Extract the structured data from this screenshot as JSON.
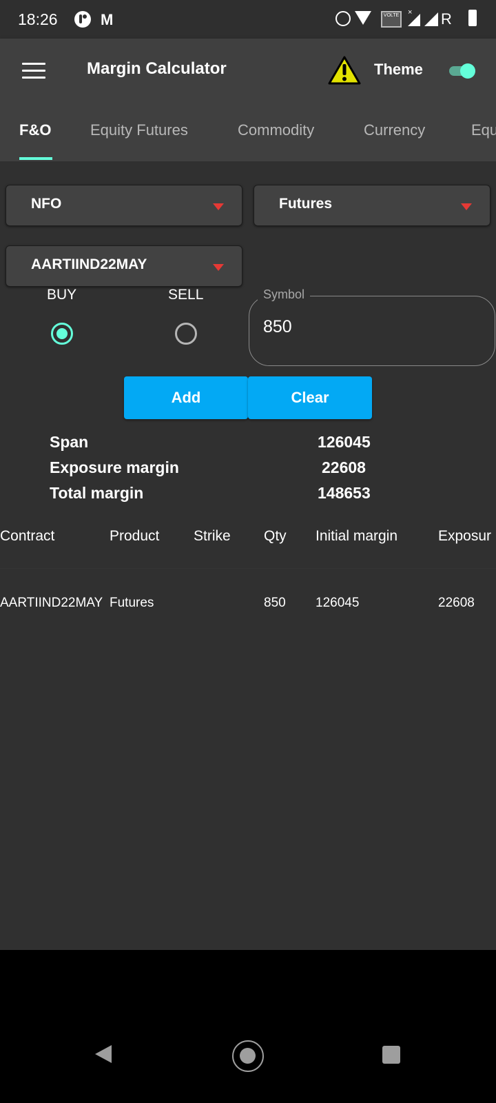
{
  "status_bar": {
    "time": "18:26",
    "left_icons": [
      "app-notification-icon",
      "gmail-icon"
    ],
    "right_icons": [
      "alarm-icon",
      "wifi-icon",
      "volte-icon",
      "signal-no-data-icon",
      "signal-icon",
      "roaming-icon",
      "battery-charging-icon"
    ],
    "volte_label": "VOLTE",
    "roaming_label": "R"
  },
  "app_bar": {
    "title": "Margin Calculator",
    "theme_label": "Theme",
    "theme_toggle_on": true
  },
  "tabs": [
    {
      "label": "F&O",
      "active": true
    },
    {
      "label": "Equity Futures",
      "active": false
    },
    {
      "label": "Commodity",
      "active": false
    },
    {
      "label": "Currency",
      "active": false
    },
    {
      "label": "Equ",
      "active": false
    }
  ],
  "form": {
    "exchange": "NFO",
    "product": "Futures",
    "contract": "AARTIIND22MAY",
    "side_options": [
      {
        "label": "BUY",
        "selected": true
      },
      {
        "label": "SELL",
        "selected": false
      }
    ],
    "symbol_label": "Symbol",
    "symbol_value": "850",
    "add_label": "Add",
    "clear_label": "Clear"
  },
  "summary": [
    {
      "label": "Span",
      "value": "126045"
    },
    {
      "label": "Exposure margin",
      "value": "22608"
    },
    {
      "label": "Total margin",
      "value": "148653"
    }
  ],
  "table": {
    "headers": [
      "Contract",
      "Product",
      "Strike",
      "Qty",
      "Initial margin",
      "Exposur"
    ],
    "rows": [
      [
        "AARTIIND22MAY",
        "Futures",
        "",
        "850",
        "126045",
        "22608"
      ]
    ]
  },
  "colors": {
    "accent": "#64ffda",
    "button": "#03a9f4",
    "dropdown_arrow": "#e53935",
    "app_bar": "#404040",
    "background": "#303030"
  }
}
